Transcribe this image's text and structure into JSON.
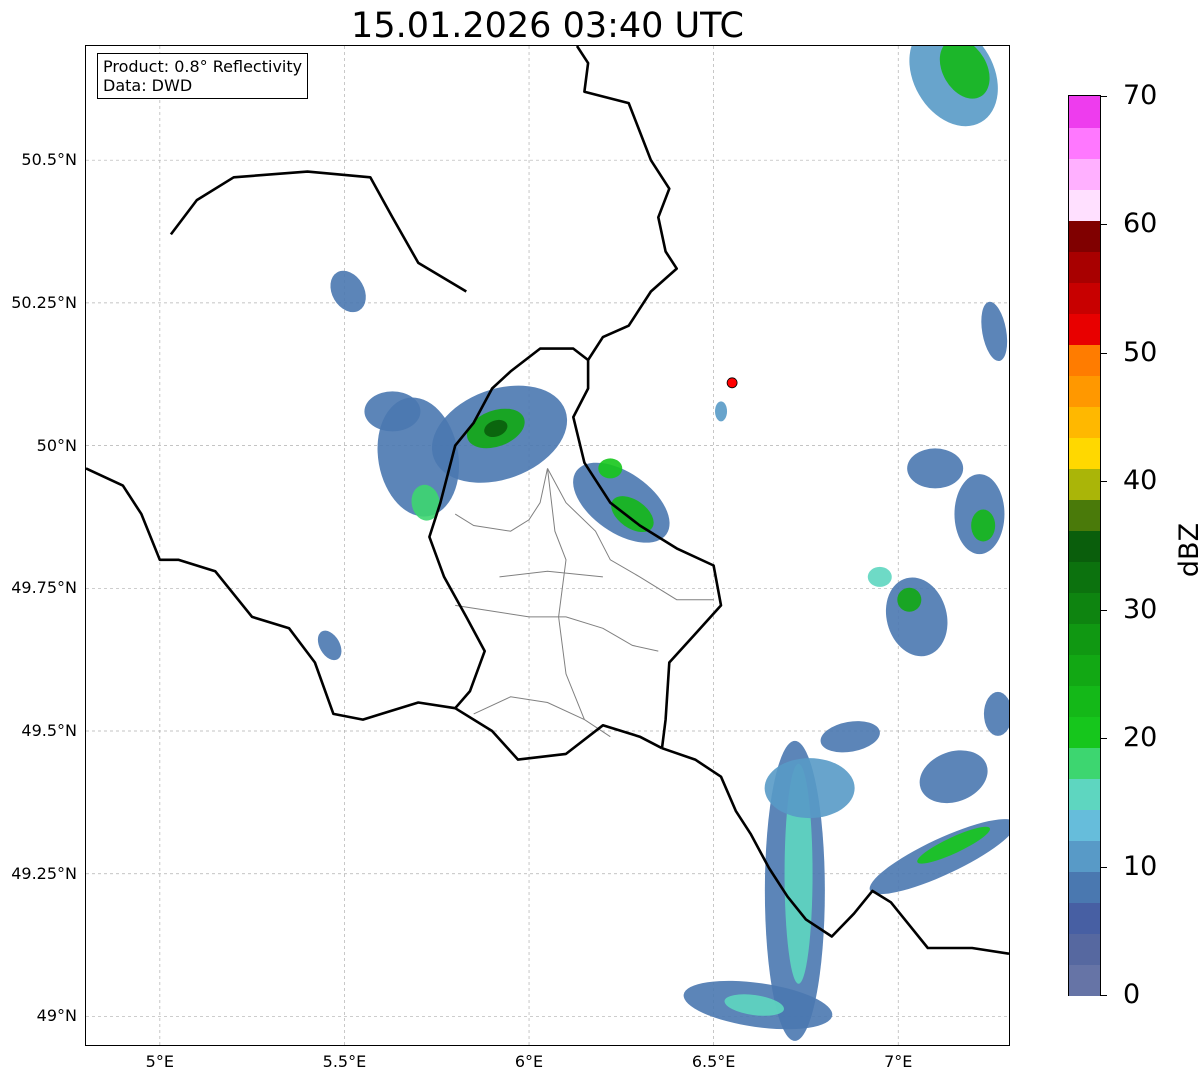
{
  "title": "15.01.2026 03:40 UTC",
  "info": {
    "product": "Product: 0.8° Reflectivity",
    "data": "Data: DWD"
  },
  "axes": {
    "lon_range": [
      4.8,
      7.3
    ],
    "lat_range": [
      48.95,
      50.7
    ],
    "lat_ticks": [
      {
        "value": 50.5,
        "label": "50.5°N"
      },
      {
        "value": 50.25,
        "label": "50.25°N"
      },
      {
        "value": 50.0,
        "label": "50°N"
      },
      {
        "value": 49.75,
        "label": "49.75°N"
      },
      {
        "value": 49.5,
        "label": "49.5°N"
      },
      {
        "value": 49.25,
        "label": "49.25°N"
      },
      {
        "value": 49.0,
        "label": "49°N"
      }
    ],
    "lon_ticks": [
      {
        "value": 5.0,
        "label": "5°E"
      },
      {
        "value": 5.5,
        "label": "5.5°E"
      },
      {
        "value": 6.0,
        "label": "6°E"
      },
      {
        "value": 6.5,
        "label": "6.5°E"
      },
      {
        "value": 7.0,
        "label": "7°E"
      }
    ],
    "gridlines": true
  },
  "radar_site": {
    "lon": 6.55,
    "lat": 50.11,
    "color": "#ff0000"
  },
  "colorbar": {
    "label": "dBZ",
    "min": 0,
    "max": 70,
    "tick_labels": [
      "70",
      "60",
      "50",
      "40",
      "30",
      "20",
      "10",
      "0"
    ],
    "tick_values": [
      70,
      60,
      50,
      40,
      30,
      20,
      10,
      0
    ],
    "colors": [
      "#6674a6",
      "#5668a0",
      "#475fa3",
      "#4a78b0",
      "#589ac7",
      "#66bddb",
      "#5ed6c0",
      "#3dd670",
      "#16c61c",
      "#14b818",
      "#12a814",
      "#109812",
      "#0e8410",
      "#0c720e",
      "#0a5e0c",
      "#4a7a0a",
      "#aab508",
      "#ffd800",
      "#ffb800",
      "#ff9800",
      "#ff7c00",
      "#e80000",
      "#c80000",
      "#a80000",
      "#800000",
      "#ffe0ff",
      "#ffb0ff",
      "#ff78ff",
      "#ee3cee"
    ]
  },
  "borders": {
    "country_lines": [
      [
        [
          5.03,
          50.37
        ],
        [
          5.1,
          50.43
        ],
        [
          5.2,
          50.47
        ],
        [
          5.4,
          50.48
        ],
        [
          5.57,
          50.47
        ],
        [
          5.63,
          50.4
        ],
        [
          5.7,
          50.32
        ],
        [
          5.83,
          50.27
        ]
      ],
      [
        [
          6.13,
          50.7
        ],
        [
          6.16,
          50.67
        ],
        [
          6.15,
          50.62
        ],
        [
          6.27,
          50.6
        ],
        [
          6.3,
          50.55
        ],
        [
          6.33,
          50.5
        ],
        [
          6.38,
          50.45
        ],
        [
          6.35,
          50.4
        ],
        [
          6.37,
          50.34
        ],
        [
          6.4,
          50.31
        ],
        [
          6.33,
          50.27
        ],
        [
          6.3,
          50.24
        ],
        [
          6.27,
          50.21
        ],
        [
          6.2,
          50.19
        ],
        [
          6.16,
          50.15
        ]
      ],
      [
        [
          6.16,
          50.15
        ],
        [
          6.12,
          50.17
        ],
        [
          6.03,
          50.17
        ],
        [
          5.95,
          50.13
        ],
        [
          5.9,
          50.1
        ],
        [
          5.85,
          50.04
        ],
        [
          5.8,
          50.0
        ],
        [
          5.76,
          49.9
        ],
        [
          5.73,
          49.84
        ],
        [
          5.77,
          49.77
        ],
        [
          5.83,
          49.7
        ],
        [
          5.88,
          49.64
        ],
        [
          5.84,
          49.57
        ],
        [
          5.8,
          49.54
        ]
      ],
      [
        [
          6.16,
          50.15
        ],
        [
          6.16,
          50.1
        ],
        [
          6.12,
          50.05
        ],
        [
          6.15,
          49.97
        ],
        [
          6.22,
          49.9
        ],
        [
          6.3,
          49.86
        ],
        [
          6.4,
          49.82
        ],
        [
          6.5,
          49.79
        ],
        [
          6.52,
          49.72
        ],
        [
          6.45,
          49.67
        ],
        [
          6.38,
          49.62
        ],
        [
          6.37,
          49.52
        ],
        [
          6.36,
          49.47
        ]
      ],
      [
        [
          5.8,
          49.54
        ],
        [
          5.9,
          49.5
        ],
        [
          5.97,
          49.45
        ],
        [
          6.1,
          49.46
        ],
        [
          6.2,
          49.51
        ],
        [
          6.3,
          49.49
        ],
        [
          6.36,
          49.47
        ]
      ],
      [
        [
          4.8,
          49.96
        ],
        [
          4.9,
          49.93
        ],
        [
          4.95,
          49.88
        ],
        [
          5.0,
          49.8
        ],
        [
          5.05,
          49.8
        ],
        [
          5.15,
          49.78
        ],
        [
          5.25,
          49.7
        ],
        [
          5.35,
          49.68
        ],
        [
          5.42,
          49.62
        ],
        [
          5.47,
          49.53
        ],
        [
          5.55,
          49.52
        ],
        [
          5.6,
          49.53
        ],
        [
          5.7,
          49.55
        ],
        [
          5.8,
          49.54
        ]
      ],
      [
        [
          6.36,
          49.47
        ],
        [
          6.45,
          49.45
        ],
        [
          6.52,
          49.42
        ],
        [
          6.56,
          49.36
        ],
        [
          6.6,
          49.32
        ],
        [
          6.65,
          49.26
        ],
        [
          6.7,
          49.21
        ],
        [
          6.75,
          49.17
        ],
        [
          6.82,
          49.14
        ],
        [
          6.88,
          49.18
        ],
        [
          6.93,
          49.22
        ],
        [
          6.98,
          49.2
        ],
        [
          7.03,
          49.16
        ],
        [
          7.08,
          49.12
        ],
        [
          7.2,
          49.12
        ],
        [
          7.3,
          49.11
        ]
      ]
    ],
    "cantons": [
      [
        [
          6.05,
          49.96
        ],
        [
          6.03,
          49.9
        ],
        [
          6.0,
          49.87
        ],
        [
          5.95,
          49.85
        ],
        [
          5.85,
          49.86
        ],
        [
          5.8,
          49.88
        ]
      ],
      [
        [
          6.05,
          49.96
        ],
        [
          6.1,
          49.9
        ],
        [
          6.18,
          49.85
        ],
        [
          6.22,
          49.8
        ],
        [
          6.3,
          49.77
        ],
        [
          6.4,
          49.73
        ],
        [
          6.5,
          49.73
        ]
      ],
      [
        [
          6.05,
          49.96
        ],
        [
          6.07,
          49.85
        ],
        [
          6.1,
          49.8
        ],
        [
          6.08,
          49.7
        ],
        [
          6.1,
          49.6
        ],
        [
          6.15,
          49.52
        ],
        [
          6.22,
          49.49
        ]
      ],
      [
        [
          5.8,
          49.72
        ],
        [
          5.9,
          49.71
        ],
        [
          6.0,
          49.7
        ],
        [
          6.1,
          49.7
        ],
        [
          6.2,
          49.68
        ],
        [
          6.28,
          49.65
        ],
        [
          6.35,
          49.64
        ]
      ],
      [
        [
          5.92,
          49.77
        ],
        [
          6.05,
          49.78
        ],
        [
          6.2,
          49.77
        ]
      ],
      [
        [
          5.85,
          49.53
        ],
        [
          5.95,
          49.56
        ],
        [
          6.05,
          49.55
        ],
        [
          6.15,
          49.52
        ]
      ]
    ]
  }
}
